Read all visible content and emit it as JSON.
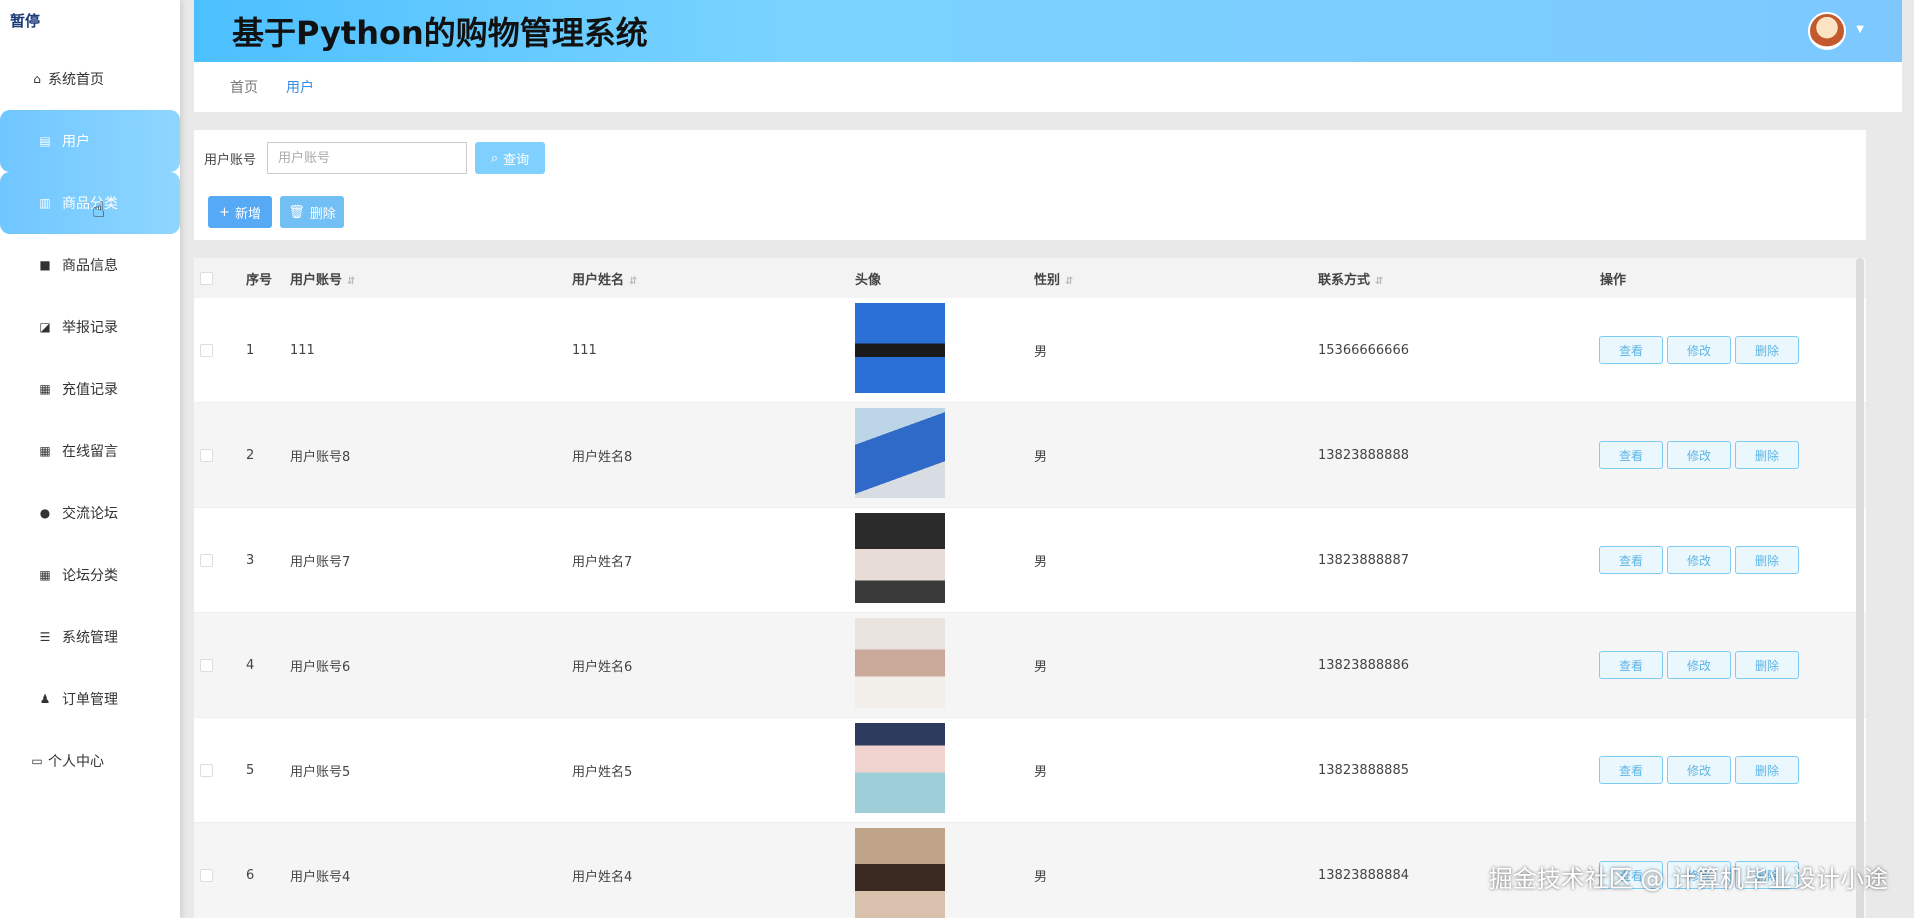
{
  "sidebar": {
    "brand": "暂停",
    "items": [
      {
        "label": "系统首页",
        "icon": "home-icon"
      },
      {
        "label": "用户",
        "icon": "clipboard-icon"
      },
      {
        "label": "商品分类",
        "icon": "bar-chart-icon"
      },
      {
        "label": "商品信息",
        "icon": "briefcase-icon"
      },
      {
        "label": "举报记录",
        "icon": "line-chart-icon"
      },
      {
        "label": "充值记录",
        "icon": "grid-icon"
      },
      {
        "label": "在线留言",
        "icon": "grid-icon"
      },
      {
        "label": "交流论坛",
        "icon": "location-icon"
      },
      {
        "label": "论坛分类",
        "icon": "grid-icon"
      },
      {
        "label": "系统管理",
        "icon": "list-icon"
      },
      {
        "label": "订单管理",
        "icon": "user-icon"
      },
      {
        "label": "个人中心",
        "icon": "calendar-icon"
      }
    ]
  },
  "header": {
    "title": "基于Python的购物管理系统"
  },
  "breadcrumb": {
    "home": "首页",
    "current": "用户"
  },
  "search": {
    "label": "用户账号",
    "placeholder": "用户账号",
    "button": "查询"
  },
  "actions": {
    "add": "新增",
    "delete": "删除"
  },
  "table": {
    "headers": {
      "index": "序号",
      "account": "用户账号",
      "name": "用户姓名",
      "avatar": "头像",
      "gender": "性别",
      "contact": "联系方式",
      "ops": "操作"
    },
    "op_labels": {
      "view": "查看",
      "edit": "修改",
      "remove": "删除"
    },
    "rows": [
      {
        "index": "1",
        "account": "111",
        "name": "111",
        "gender": "男",
        "contact": "15366666666"
      },
      {
        "index": "2",
        "account": "用户账号8",
        "name": "用户姓名8",
        "gender": "男",
        "contact": "13823888888"
      },
      {
        "index": "3",
        "account": "用户账号7",
        "name": "用户姓名7",
        "gender": "男",
        "contact": "13823888887"
      },
      {
        "index": "4",
        "account": "用户账号6",
        "name": "用户姓名6",
        "gender": "男",
        "contact": "13823888886"
      },
      {
        "index": "5",
        "account": "用户账号5",
        "name": "用户姓名5",
        "gender": "男",
        "contact": "13823888885"
      },
      {
        "index": "6",
        "account": "用户账号4",
        "name": "用户姓名4",
        "gender": "男",
        "contact": "13823888884"
      }
    ]
  },
  "watermark": "掘金技术社区 @ 计算机毕业设计小途"
}
